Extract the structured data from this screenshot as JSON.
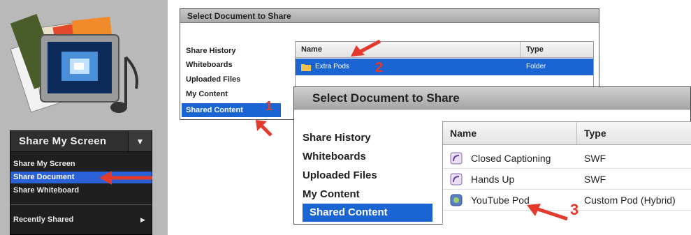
{
  "left_panel": {
    "share_button": "Share My Screen",
    "menu": [
      "Share My Screen",
      "Share Document",
      "Share Whiteboard"
    ],
    "selected_index": 1,
    "recently_shared": "Recently Shared"
  },
  "dialog1": {
    "title": "Select Document to Share",
    "nav": [
      "Share History",
      "Whiteboards",
      "Uploaded Files",
      "My Content",
      "Shared Content"
    ],
    "selected_nav": 4,
    "columns": [
      "Name",
      "Type"
    ],
    "rows": [
      {
        "name": "Extra Pods",
        "type": "Folder"
      }
    ]
  },
  "dialog2": {
    "title": "Select Document to Share",
    "nav": [
      "Share History",
      "Whiteboards",
      "Uploaded Files",
      "My Content",
      "Shared Content"
    ],
    "selected_nav": 4,
    "columns": [
      "Name",
      "Type"
    ],
    "rows": [
      {
        "name": "Closed Captioning",
        "type": "SWF"
      },
      {
        "name": "Hands Up",
        "type": "SWF"
      },
      {
        "name": "YouTube Pod",
        "type": "Custom Pod (Hybrid)"
      }
    ]
  },
  "annotations": {
    "n1": "1",
    "n2": "2",
    "n3": "3"
  },
  "colors": {
    "selection": "#1a64d4",
    "annotation": "#e23a2c",
    "panel": "#b9b9b9"
  }
}
